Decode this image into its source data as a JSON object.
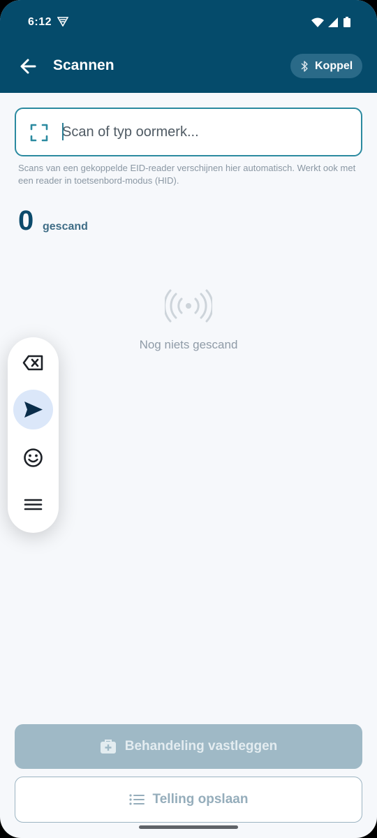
{
  "status_bar": {
    "time": "6:12",
    "icons": [
      "sim-card-icon",
      "wifi-icon",
      "signal-icon",
      "battery-icon"
    ]
  },
  "header": {
    "title": "Scannen",
    "back_icon": "arrow-left-icon",
    "pair_button": {
      "icon": "bluetooth-icon",
      "label": "Koppel"
    }
  },
  "scan": {
    "icon": "scan-frame-icon",
    "placeholder": "Scan of typ oormerk...",
    "value": "",
    "hint": "Scans van een gekoppelde EID-reader verschijnen hier automatisch. Werkt ook met een reader in toetsenbord-modus (HID)."
  },
  "counter": {
    "value": "0",
    "label": "gescand"
  },
  "empty_state": {
    "icon": "radio-waves-icon",
    "text": "Nog niets gescand"
  },
  "floating_toolbar": {
    "items": [
      {
        "name": "backspace",
        "icon": "backspace-icon",
        "active": false
      },
      {
        "name": "send",
        "icon": "send-icon",
        "active": true
      },
      {
        "name": "emoji",
        "icon": "emoji-icon",
        "active": false
      },
      {
        "name": "menu",
        "icon": "menu-icon",
        "active": false
      }
    ]
  },
  "actions": {
    "primary": {
      "icon": "first-aid-kit-icon",
      "label": "Behandeling vastleggen",
      "disabled": true
    },
    "secondary": {
      "icon": "list-icon",
      "label": "Telling opslaan",
      "disabled": true
    }
  },
  "colors": {
    "header_bg": "#054b6b",
    "accent": "#2b8aa0",
    "count": "#0b4a6b",
    "primary_disabled": "#9fb9c6",
    "background": "#f6f8fb"
  }
}
